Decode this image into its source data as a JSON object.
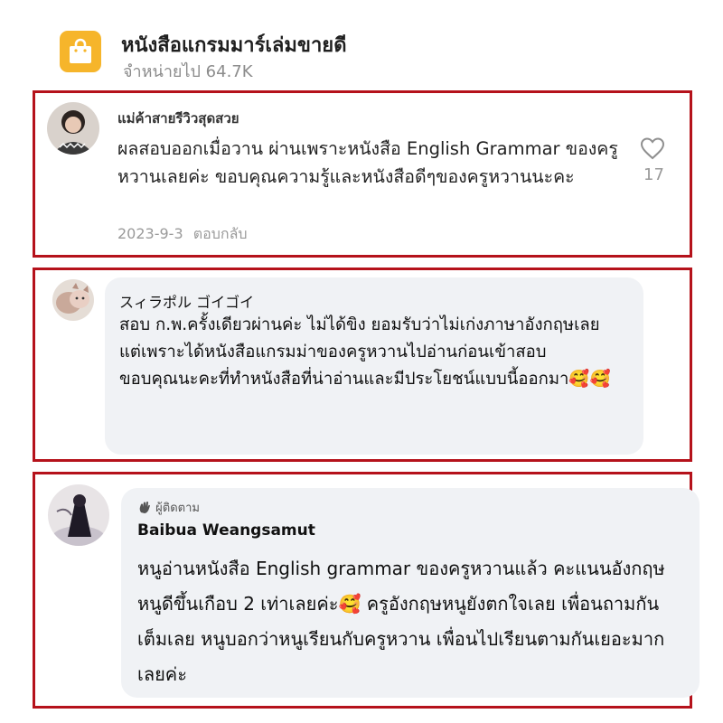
{
  "header": {
    "title": "หนังสือแกรมมาร์เล่มขายดี",
    "subtitle": "จำหน่ายไป 64.7K",
    "icon": "shopping-bag-icon",
    "icon_color": "#f6b52b"
  },
  "reviews": [
    {
      "name": "แม่ค้าสายรีวิวสุดสวย",
      "text": "ผลสอบออกเมื่อวาน ผ่านเพราะหนังสือ English Grammar ของครูหวานเลยค่ะ ขอบคุณความรู้และหนังสือดีๆของครูหวานนะคะ",
      "date": "2023-9-3",
      "reply_label": "ตอบกลับ",
      "likes": "17",
      "like_icon": "heart-outline-icon"
    },
    {
      "name": "スィラポル ゴイゴイ",
      "text": "สอบ ก.พ.ครั้งเดียวผ่านค่ะ ไม่ได้ขิง ยอมรับว่าไม่เก่งภาษาอังกฤษเลย\nแต่เพราะได้หนังสือแกรมม่าของครูหวานไปอ่านก่อนเข้าสอบ\nขอบคุณนะคะที่ทำหนังสือที่น่าอ่านและมีประโยชน์แบบนี้ออกมา🥰🥰"
    },
    {
      "badge": "ผู้ติดตาม",
      "badge_icon": "waving-hand-icon",
      "name": "Baibua Weangsamut",
      "text": "หนูอ่านหนังสือ English grammar ของครูหวานแล้ว คะแนนอังกฤษหนูดีขึ้นเกือบ 2 เท่าเลยค่ะ🥰 ครูอังกฤษหนูยังตกใจเลย เพื่อนถามกันเต็มเลย หนูบอกว่าหนูเรียนกับครูหวาน เพื่อนไปเรียนตามกันเยอะมากเลยค่ะ"
    }
  ],
  "colors": {
    "frame": "#b5121b",
    "bubble": "#f0f2f5",
    "muted_text": "#9a9a9a"
  }
}
